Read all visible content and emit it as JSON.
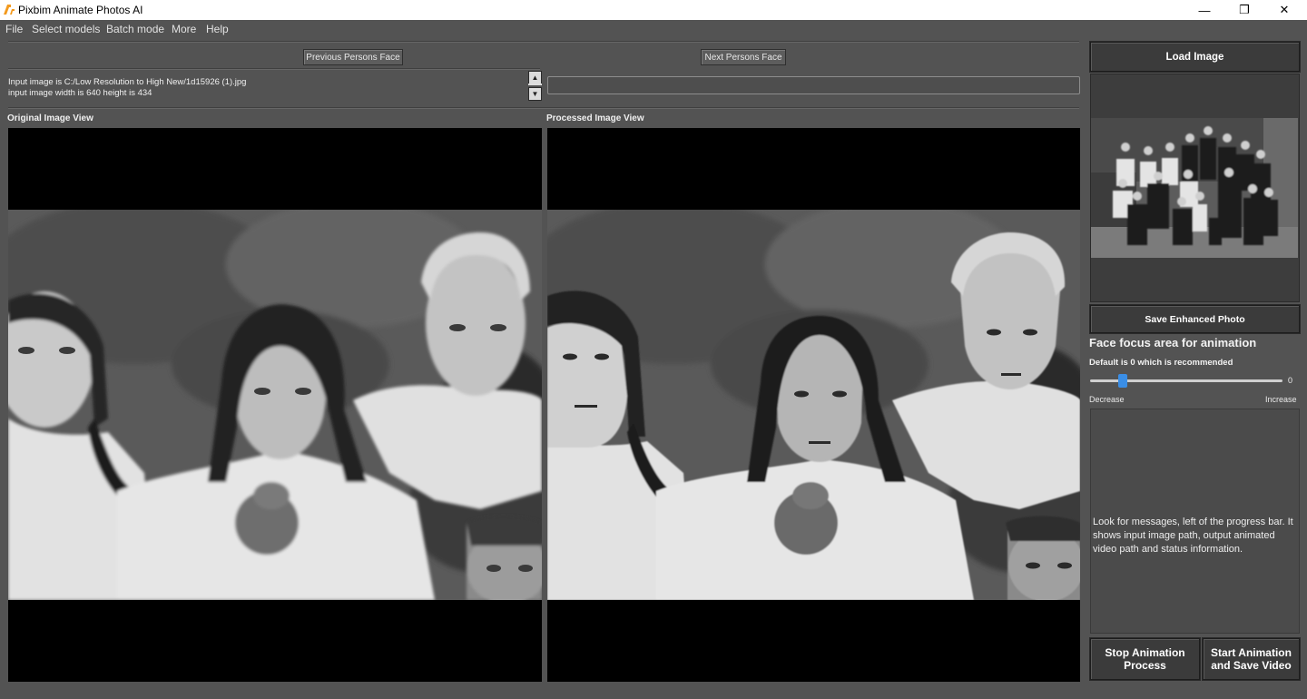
{
  "window": {
    "title": "Pixbim Animate Photos AI",
    "controls": {
      "minimize": "—",
      "maximize": "❐",
      "close": "✕"
    }
  },
  "menu": [
    "File",
    "Select models",
    "Batch mode",
    "More",
    "Help"
  ],
  "toolbar": {
    "prev_face_label": "Previous Persons Face",
    "next_face_label": "Next Persons Face"
  },
  "info": {
    "line1": "Input image is C:/Low Resolution to High New/1d15926 (1).jpg",
    "line2": "input image width is 640 height is 434"
  },
  "status_field_value": "",
  "views": {
    "original_label": "Original Image View",
    "processed_label": "Processed Image View"
  },
  "right_panel": {
    "load_label": "Load Image",
    "save_label": "Save Enhanced Photo",
    "focus_title": "Face focus area for animation",
    "focus_default": "Default is 0 which is recommended",
    "slider_value": "0",
    "slider_level_fraction": 0.17,
    "decrease_label": "Decrease",
    "increase_label": "Increase",
    "message": "Look for messages, left of the progress bar. It shows input image path, output animated video path and status information.",
    "stop_label": "Stop Animation Process",
    "start_label": "Start Animation and Save Video"
  },
  "icons": {
    "logo": "pixbim-logo-icon",
    "spin_up": "spin-up-icon",
    "spin_down": "spin-down-icon"
  },
  "colors": {
    "background": "#535353",
    "button": "#3b3b3b",
    "slider_accent": "#3a8ee6",
    "logo_orange": "#f39a1e"
  }
}
